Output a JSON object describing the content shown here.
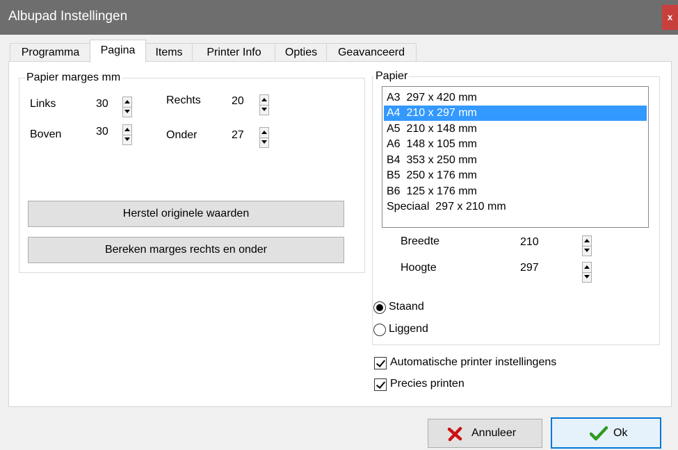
{
  "window": {
    "title": "Albupad Instellingen",
    "close_glyph": "x"
  },
  "tabs": [
    "Programma",
    "Pagina",
    "Items",
    "Printer Info",
    "Opties",
    "Geavanceerd"
  ],
  "active_tab": "Pagina",
  "margins": {
    "legend": "Papier marges mm",
    "links_label": "Links",
    "links_value": "30",
    "rechts_label": "Rechts",
    "rechts_value": "20",
    "boven_label": "Boven",
    "boven_value": "30",
    "onder_label": "Onder",
    "onder_value": "27",
    "reset_button": "Herstel originele waarden",
    "calc_button": "Bereken marges rechts en onder"
  },
  "paper": {
    "legend": "Papier",
    "items": [
      "A3  297 x 420 mm",
      "A4  210 x 297 mm",
      "A5  210 x 148 mm",
      "A6  148 x 105 mm",
      "B4  353 x 250 mm",
      "B5  250 x 176 mm",
      "B6  125 x 176 mm",
      "Speciaal  297 x 210 mm"
    ],
    "selected_index": 1,
    "breedte_label": "Breedte",
    "breedte_value": "210",
    "hoogte_label": "Hoogte",
    "hoogte_value": "297",
    "orientation_portrait": "Staand",
    "orientation_landscape": "Liggend",
    "orientation_selected": "Staand"
  },
  "options": {
    "auto_printer_label": "Automatische printer instellingens",
    "auto_printer_checked": true,
    "precise_label": "Precies printen",
    "precise_checked": true
  },
  "buttons": {
    "cancel": "Annuleer",
    "ok": "Ok"
  },
  "colors": {
    "selection": "#3399ff",
    "titlebar": "#6e6e6e",
    "close": "#c8403c",
    "cancel_icon": "#cc1111",
    "ok_icon": "#2e9a1e",
    "default_button_border": "#0078d7"
  }
}
